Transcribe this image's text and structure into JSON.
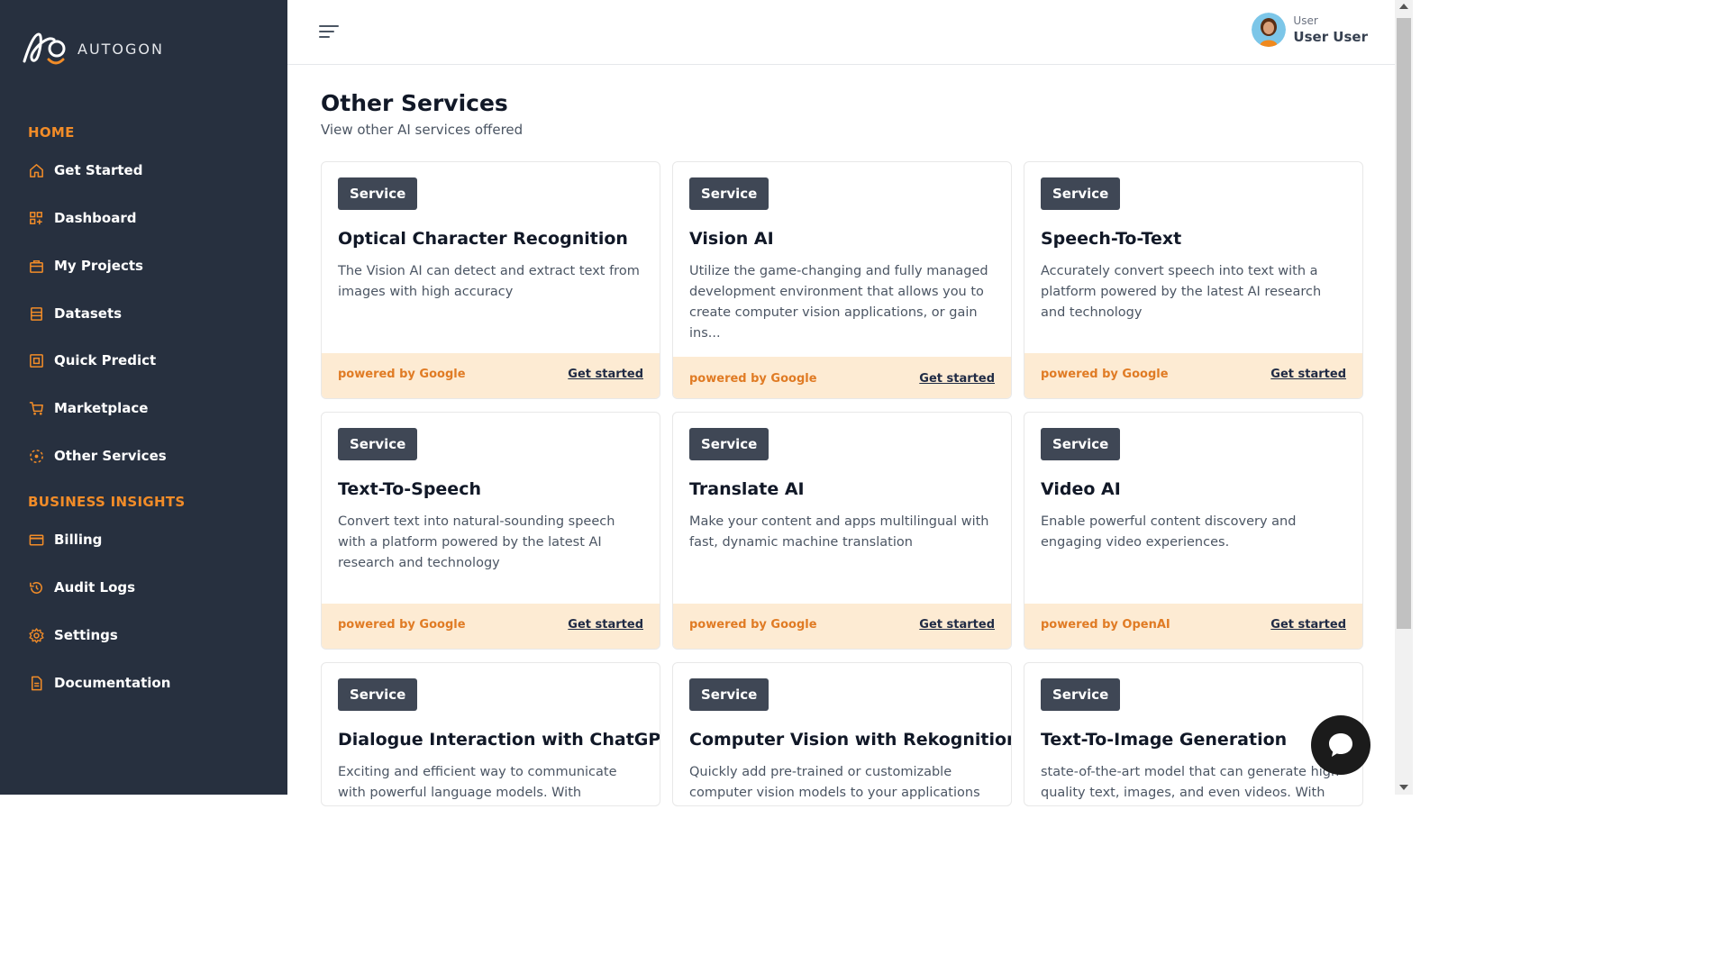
{
  "brand": {
    "name": "AUTOGON"
  },
  "colors": {
    "sidebar_bg": "#27303f",
    "accent": "#f28c28",
    "badge_bg": "#3f4755",
    "card_footer_bg": "#fdebd3",
    "powered_text": "#e07b24"
  },
  "sidebar": {
    "sections": [
      {
        "title": "HOME"
      },
      {
        "title": "BUSINESS INSIGHTS"
      }
    ],
    "items": [
      {
        "label": "Get Started",
        "icon": "home-icon"
      },
      {
        "label": "Dashboard",
        "icon": "dashboard-icon"
      },
      {
        "label": "My Projects",
        "icon": "briefcase-icon"
      },
      {
        "label": "Datasets",
        "icon": "dataset-icon"
      },
      {
        "label": "Quick Predict",
        "icon": "predict-icon"
      },
      {
        "label": "Marketplace",
        "icon": "cart-icon"
      },
      {
        "label": "Other Services",
        "icon": "services-icon"
      },
      {
        "label": "Billing",
        "icon": "billing-card-icon"
      },
      {
        "label": "Audit Logs",
        "icon": "history-icon"
      },
      {
        "label": "Settings",
        "icon": "gear-icon"
      },
      {
        "label": "Documentation",
        "icon": "document-icon"
      }
    ]
  },
  "header": {
    "menu_icon": "hamburger-menu-icon",
    "user": {
      "role": "User",
      "name": "User User"
    }
  },
  "main": {
    "title": "Other Services",
    "subtitle": "View other AI services offered",
    "cards": [
      {
        "badge": "Service",
        "title": "Optical Character Recognition",
        "desc": "The Vision AI can detect and extract text from images with high accuracy",
        "powered": "powered by Google",
        "cta": "Get started"
      },
      {
        "badge": "Service",
        "title": "Vision AI",
        "desc": "Utilize the game-changing and fully managed development environment that allows you to create computer vision applications, or gain ins...",
        "powered": "powered by Google",
        "cta": "Get started"
      },
      {
        "badge": "Service",
        "title": "Speech-To-Text",
        "desc": "Accurately convert speech into text with a platform powered by the latest AI research and technology",
        "powered": "powered by Google",
        "cta": "Get started"
      },
      {
        "badge": "Service",
        "title": "Text-To-Speech",
        "desc": "Convert text into natural-sounding speech with a platform powered by the latest AI research and technology",
        "powered": "powered by Google",
        "cta": "Get started"
      },
      {
        "badge": "Service",
        "title": "Translate AI",
        "desc": "Make your content and apps multilingual with fast, dynamic machine translation",
        "powered": "powered by Google",
        "cta": "Get started"
      },
      {
        "badge": "Service",
        "title": "Video AI",
        "desc": "Enable powerful content discovery and engaging video experiences.",
        "powered": "powered by OpenAI",
        "cta": "Get started"
      },
      {
        "badge": "Service",
        "title": "Dialogue Interaction with ChatGPT",
        "desc": "Exciting and efficient way to communicate with powerful language models. With ChatGPT, you",
        "powered": "",
        "cta": ""
      },
      {
        "badge": "Service",
        "title": "Computer Vision with Rekognition",
        "desc": "Quickly add pre-trained or customizable computer vision models to your applications",
        "powered": "",
        "cta": ""
      },
      {
        "badge": "Service",
        "title": "Text-To-Image Generation",
        "desc": "state-of-the-art model that can generate high-quality text, images, and even videos. With",
        "powered": "",
        "cta": ""
      }
    ]
  },
  "chat": {
    "icon": "chat-bubble-icon"
  }
}
